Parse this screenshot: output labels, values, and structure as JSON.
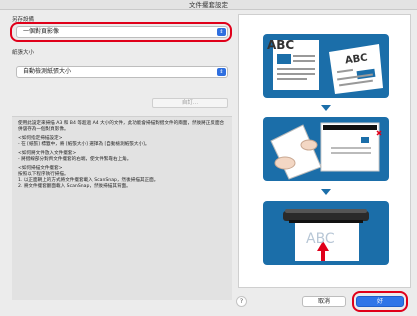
{
  "window": {
    "title": "文件擺套設定"
  },
  "save_type": {
    "label": "另存設備",
    "value": "一個對頁影像"
  },
  "paper_size": {
    "label": "紙張大小",
    "value": "自動檢測紙張大小",
    "custom_label": "自訂..."
  },
  "description": {
    "intro": "使用此設定來掃描 A3 和 B4 等超過 A4 大小的文件，此功能會掃描對摺文件的兩面，然後將正反面合併儲存為一個對頁影像。",
    "q1_title": "<如何指定掃描設定>",
    "q1_body": "- 在 [紙張] 標籤中，將 [紙張大小] 選擇為 [自動檢測紙張大小]。",
    "q2_title": "<如何將文件放入文件擺套>",
    "q2_body": "- 將摺線部分對齊文件擺套的右端，使文件緊靠右上角。",
    "q3_title": "<如何掃描文件擺套>",
    "q3_intro": "按照以下程序執行掃描。",
    "q3_step1": "1. 以正面朝上的方式將文件擺套載入 ScanSnap，然後掃描其正面。",
    "q3_step2": "2. 將文件擺套翻面載入 ScanSnap，然後掃描其背面。"
  },
  "illustration": {
    "abc": "ABC"
  },
  "footer": {
    "help": "?",
    "cancel": "取消",
    "ok": "好"
  },
  "colors": {
    "accent": "#2f75e8",
    "highlight": "#e0001a",
    "card": "#1b6ea9"
  }
}
